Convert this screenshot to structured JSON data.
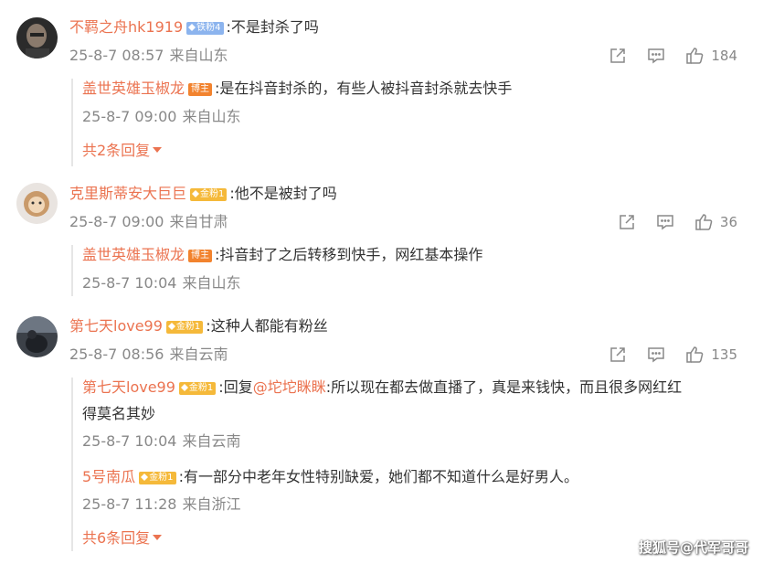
{
  "comments": [
    {
      "user": "不羁之舟hk1919",
      "badge": "铁粉4",
      "text": "不是封杀了吗",
      "time": "25-8-7 08:57",
      "location": "来自山东",
      "likes": "184",
      "replies": [
        {
          "user": "盖世英雄玉椒龙",
          "badge": "博主",
          "text": "是在抖音封杀的，有些人被抖音封杀就去快手",
          "time": "25-8-7 09:00",
          "location": "来自山东"
        }
      ],
      "more_replies": "共2条回复"
    },
    {
      "user": "克里斯蒂安大巨巨",
      "badge": "金粉1",
      "text": "他不是被封了吗",
      "time": "25-8-7 09:00",
      "location": "来自甘肃",
      "likes": "36",
      "replies": [
        {
          "user": "盖世英雄玉椒龙",
          "badge": "博主",
          "text": "抖音封了之后转移到快手，网红基本操作",
          "time": "25-8-7 10:04",
          "location": "来自山东"
        }
      ]
    },
    {
      "user": "第七天love99",
      "badge": "金粉1",
      "text": "这种人都能有粉丝",
      "time": "25-8-7 08:56",
      "location": "来自云南",
      "likes": "135",
      "replies": [
        {
          "user": "第七天love99",
          "badge": "金粉1",
          "reply_prefix": "回复",
          "mention": "@坨坨眯眯",
          "text": "所以现在都去做直播了，真是来钱快，而且很多网红红",
          "text_line2": "得莫名其妙",
          "time": "25-8-7 10:04",
          "location": "来自云南"
        },
        {
          "user": "5号南瓜",
          "badge": "金粉1",
          "text": "有一部分中老年女性特别缺爱，她们都不知道什么是好男人。",
          "time": "25-8-7 11:28",
          "location": "来自浙江"
        }
      ],
      "more_replies": "共6条回复"
    }
  ],
  "colon": ":",
  "watermark": "搜狐号@代军哥哥",
  "colors": {
    "username": "#eb7350",
    "meta": "#888888",
    "badge_blue": "#8cb4ee",
    "badge_gold": "#f5b93a",
    "badge_host": "#f2832e"
  },
  "icons": [
    "share-icon",
    "comment-icon",
    "like-icon",
    "fan-badge-icon",
    "caret-down-icon"
  ]
}
